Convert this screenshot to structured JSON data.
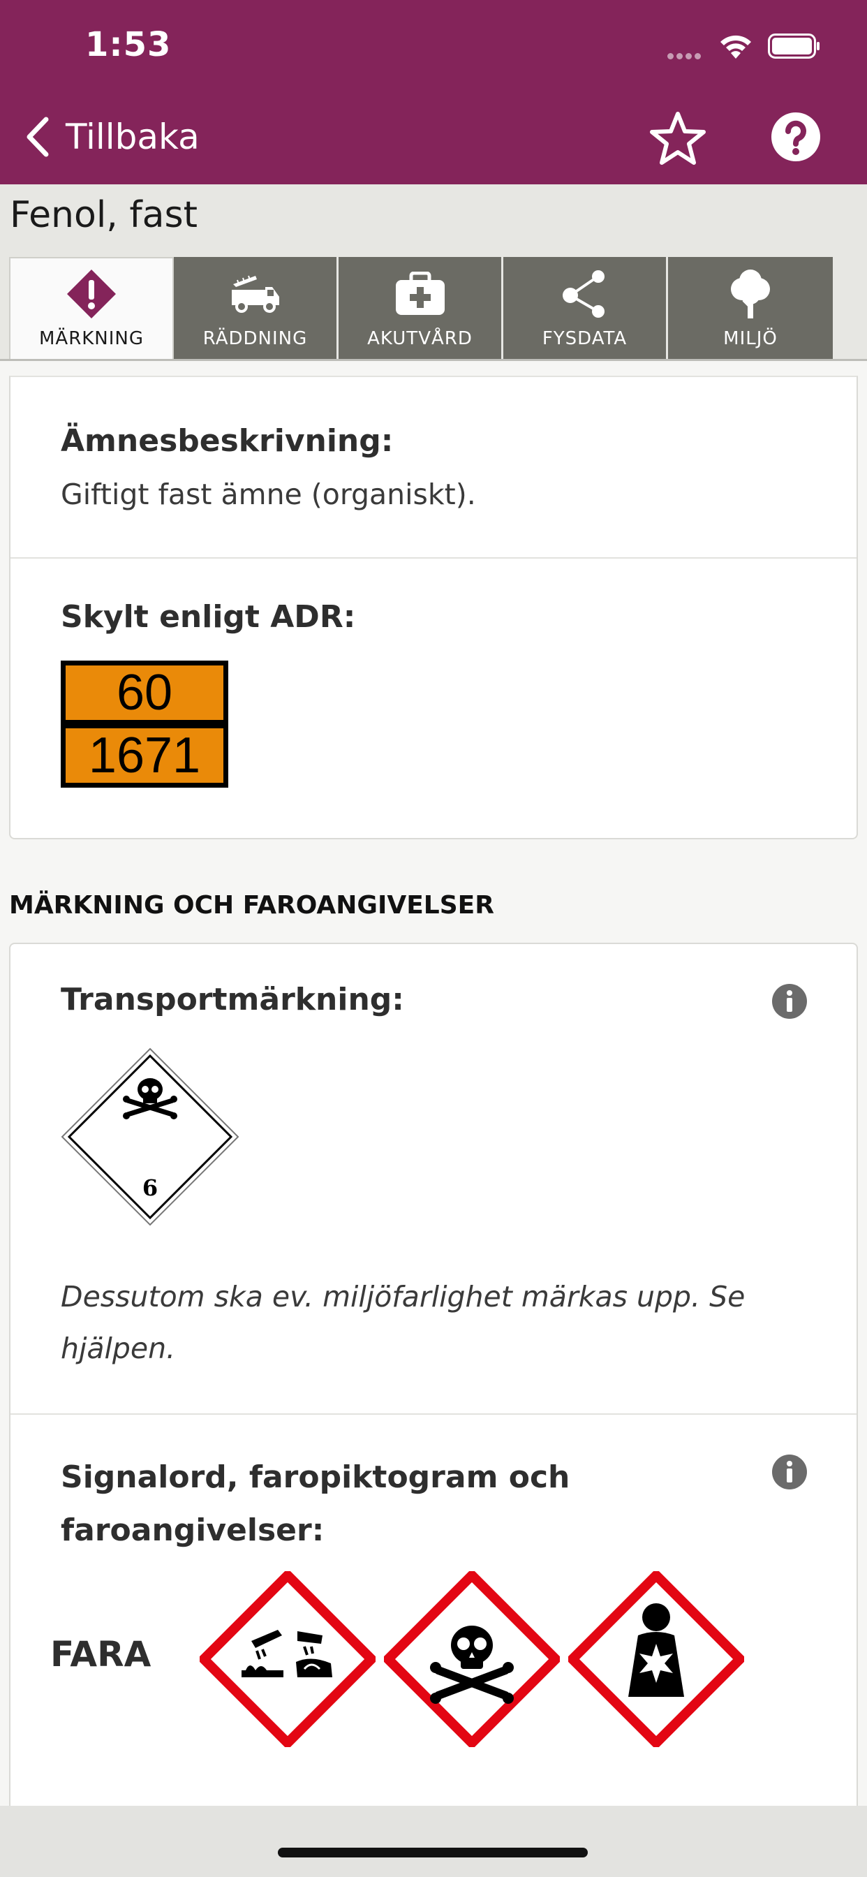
{
  "status_bar": {
    "time": "1:53"
  },
  "nav": {
    "back_label": "Tillbaka"
  },
  "page": {
    "title": "Fenol, fast"
  },
  "tabs": [
    {
      "label": "MÄRKNING",
      "icon": "exclamation-diamond-icon",
      "active": true
    },
    {
      "label": "RÄDDNING",
      "icon": "fire-truck-icon",
      "active": false
    },
    {
      "label": "AKUTVÅRD",
      "icon": "first-aid-kit-icon",
      "active": false
    },
    {
      "label": "FYSDATA",
      "icon": "molecule-icon",
      "active": false
    },
    {
      "label": "MILJÖ",
      "icon": "tree-icon",
      "active": false
    }
  ],
  "substance": {
    "description_label": "Ämnesbeskrivning:",
    "description_value": "Giftigt fast ämne (organiskt).",
    "adr_label": "Skylt enligt ADR:",
    "adr_hazard_number": "60",
    "adr_un_number": "1671"
  },
  "labeling": {
    "section_heading": "MÄRKNING OCH FAROANGIVELSER",
    "transport_label": "Transportmärkning:",
    "transport_class": "6",
    "transport_note": "Dessutom ska ev. miljöfarlighet märkas upp. Se hjälpen.",
    "signal_label": "Signalord, faropiktogram och faroangivelser:",
    "signal_word": "FARA",
    "pictograms": [
      "corrosion-pictogram-icon",
      "skull-crossbones-pictogram-icon",
      "health-hazard-pictogram-icon"
    ]
  },
  "colors": {
    "header": "#84245a",
    "tab_inactive": "#6b6b64",
    "adr_orange": "#ea8a09",
    "ghs_red": "#e30613",
    "active_tab_icon": "#84245a"
  }
}
